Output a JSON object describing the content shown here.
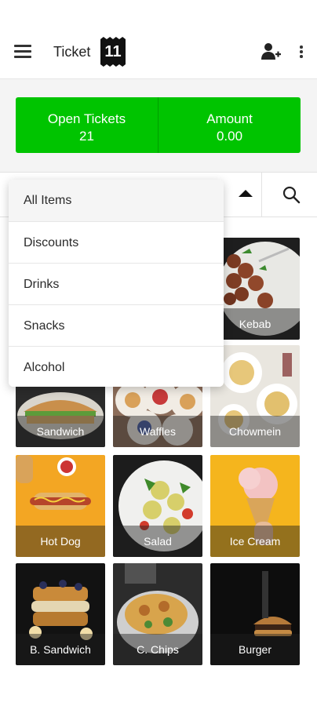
{
  "header": {
    "title": "Ticket",
    "ticket_count": "11",
    "menu_icon": "hamburger-menu-icon",
    "add_icon": "add-customer-icon",
    "more_icon": "more-vert-icon"
  },
  "summary": {
    "open_tickets_label": "Open Tickets",
    "open_tickets_value": "21",
    "amount_label": "Amount",
    "amount_value": "0.00",
    "color": "#00c400"
  },
  "filter": {
    "caret_icon": "caret-up-icon",
    "search_icon": "search-icon"
  },
  "dropdown": {
    "items": [
      "All Items",
      "Discounts",
      "Drinks",
      "Snacks",
      "Alcohol"
    ],
    "selected": "All Items"
  },
  "items": [
    {
      "label": "Kebab"
    },
    {
      "label": "Sandwich"
    },
    {
      "label": "Waffles"
    },
    {
      "label": "Chowmein"
    },
    {
      "label": "Hot Dog"
    },
    {
      "label": "Salad"
    },
    {
      "label": "Ice Cream"
    },
    {
      "label": "B. Sandwich"
    },
    {
      "label": "C. Chips"
    },
    {
      "label": "Burger"
    }
  ]
}
